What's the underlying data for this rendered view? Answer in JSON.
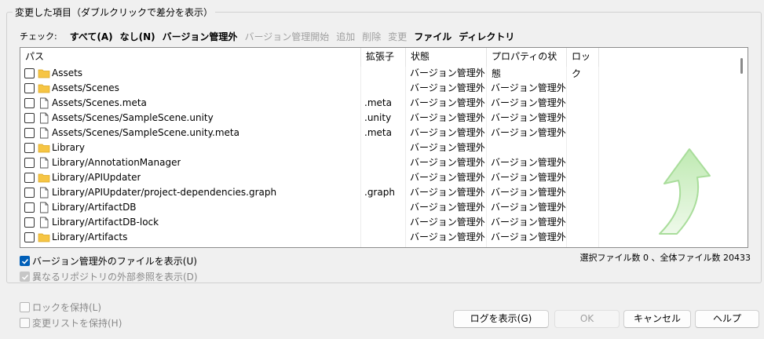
{
  "group_title": "変更した項目（ダブルクリックで差分を表示）",
  "check_bar": {
    "label": "チェック:",
    "links": [
      {
        "label": "すべて(A)",
        "enabled": true
      },
      {
        "label": "なし(N)",
        "enabled": true
      },
      {
        "label": "バージョン管理外",
        "enabled": true
      },
      {
        "label": "バージョン管理開始",
        "enabled": false
      },
      {
        "label": "追加",
        "enabled": false
      },
      {
        "label": "削除",
        "enabled": false
      },
      {
        "label": "変更",
        "enabled": false
      },
      {
        "label": "ファイル",
        "enabled": true
      },
      {
        "label": "ディレクトリ",
        "enabled": true
      }
    ]
  },
  "columns": {
    "path": "パス",
    "ext": "拡張子",
    "status": "状態",
    "prop_status": "プロパティの状態",
    "lock": "ロック"
  },
  "rows": [
    {
      "path": "Assets",
      "type": "folder",
      "ext": "",
      "status": "バージョン管理外",
      "prop_status": ""
    },
    {
      "path": "Assets/Scenes",
      "type": "folder",
      "ext": "",
      "status": "バージョン管理外",
      "prop_status": "バージョン管理外"
    },
    {
      "path": "Assets/Scenes.meta",
      "type": "file",
      "ext": ".meta",
      "status": "バージョン管理外",
      "prop_status": "バージョン管理外"
    },
    {
      "path": "Assets/Scenes/SampleScene.unity",
      "type": "file",
      "ext": ".unity",
      "status": "バージョン管理外",
      "prop_status": "バージョン管理外"
    },
    {
      "path": "Assets/Scenes/SampleScene.unity.meta",
      "type": "file",
      "ext": ".meta",
      "status": "バージョン管理外",
      "prop_status": "バージョン管理外"
    },
    {
      "path": "Library",
      "type": "folder",
      "ext": "",
      "status": "バージョン管理外",
      "prop_status": ""
    },
    {
      "path": "Library/AnnotationManager",
      "type": "file",
      "ext": "",
      "status": "バージョン管理外",
      "prop_status": "バージョン管理外"
    },
    {
      "path": "Library/APIUpdater",
      "type": "folder",
      "ext": "",
      "status": "バージョン管理外",
      "prop_status": "バージョン管理外"
    },
    {
      "path": "Library/APIUpdater/project-dependencies.graph",
      "type": "file",
      "ext": ".graph",
      "status": "バージョン管理外",
      "prop_status": "バージョン管理外"
    },
    {
      "path": "Library/ArtifactDB",
      "type": "file",
      "ext": "",
      "status": "バージョン管理外",
      "prop_status": "バージョン管理外"
    },
    {
      "path": "Library/ArtifactDB-lock",
      "type": "file",
      "ext": "",
      "status": "バージョン管理外",
      "prop_status": "バージョン管理外"
    },
    {
      "path": "Library/Artifacts",
      "type": "folder",
      "ext": "",
      "status": "バージョン管理外",
      "prop_status": "バージョン管理外"
    }
  ],
  "options": {
    "show_unversioned": "バージョン管理外のファイルを表示(U)",
    "show_externals": "異なるリポジトリの外部参照を表示(D)",
    "keep_locks": "ロックを保持(L)",
    "keep_changelists": "変更リストを保持(H)"
  },
  "file_count": "選択ファイル数 0 、全体ファイル数 20433",
  "buttons": {
    "show_log": "ログを表示(G)",
    "ok": "OK",
    "cancel": "キャンセル",
    "help": "ヘルプ"
  },
  "colors": {
    "accent": "#005fb8",
    "folder": "#f6c544",
    "arrow": "#c9eebf"
  }
}
